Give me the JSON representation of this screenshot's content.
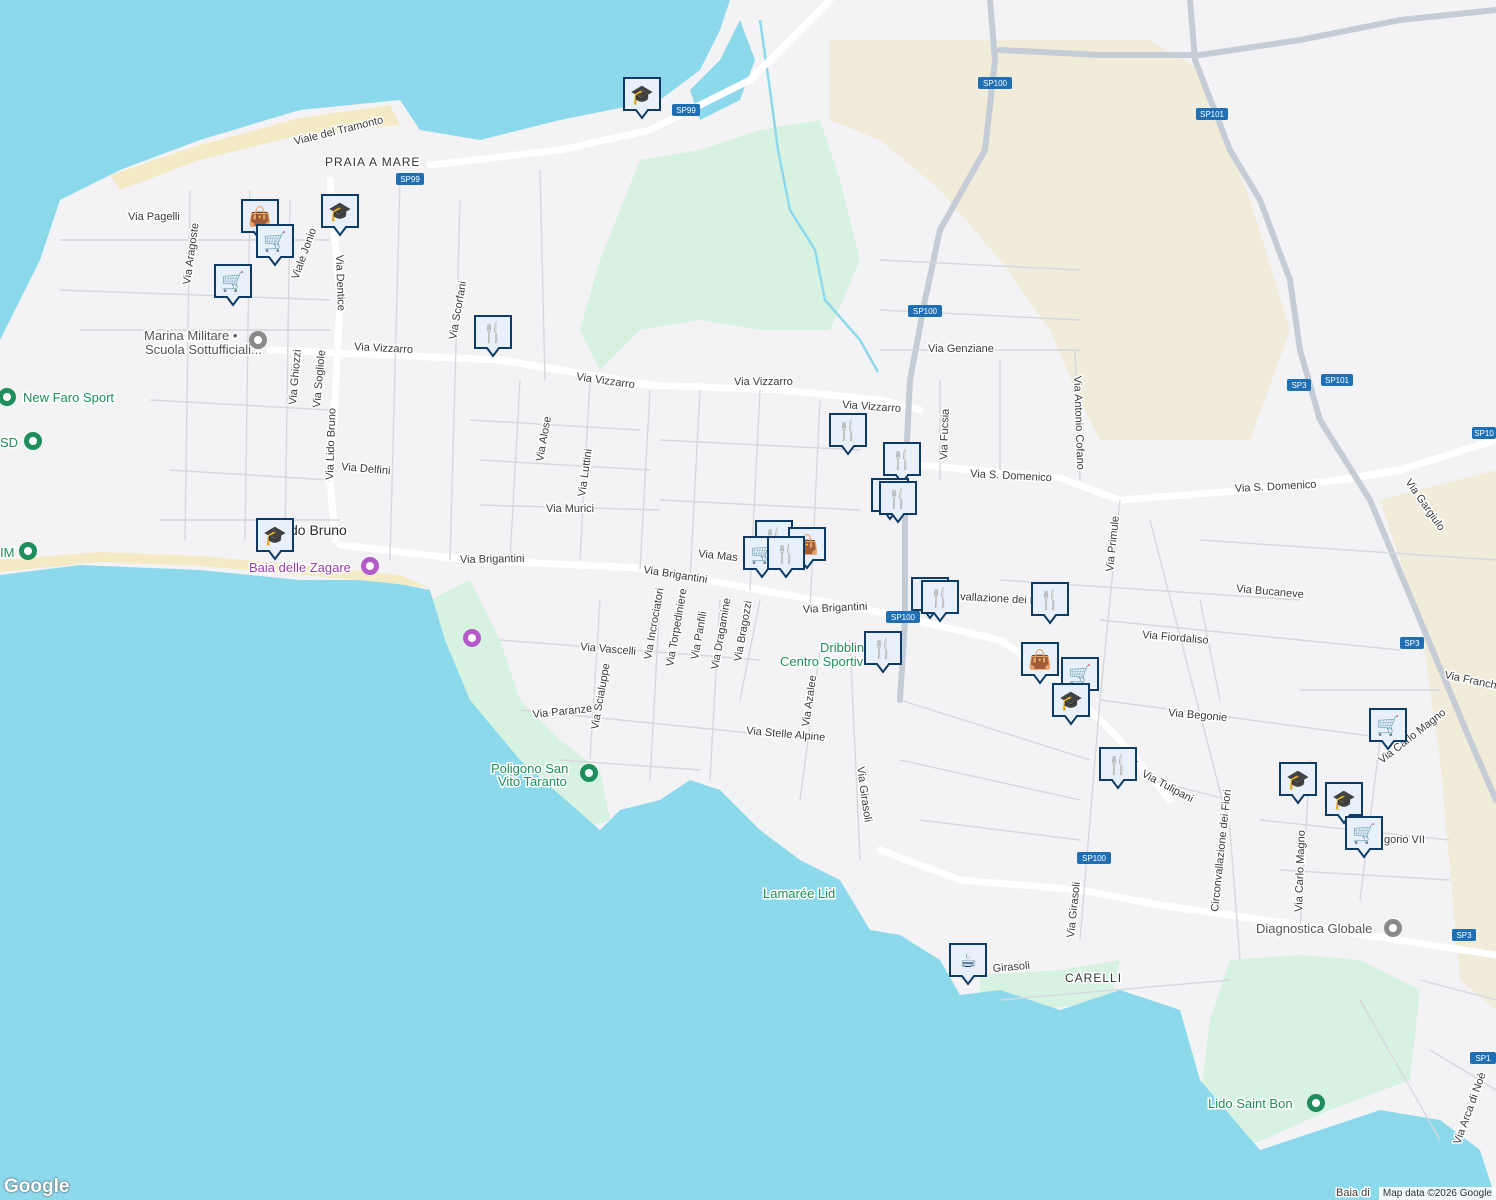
{
  "colors": {
    "water": "#8dd9ec",
    "land": "#f3f3f5",
    "park": "#d8f2e2",
    "agricultural": "#f1ebd9",
    "beach": "#f5eac6",
    "road": "#ffffff",
    "highway": "#c4ccd5",
    "marker_fill": "#e8f1fb",
    "marker_border": "#0d3b66"
  },
  "streets": {
    "viale_tramonto": "Viale del Tramonto",
    "praia_a_mare": "PRAIA A MARE",
    "via_pagelli": "Via Pagelli",
    "via_aragoste": "Via Aragoste",
    "viale_jonio": "Viale Jonio",
    "via_dentice": "Via Dentice",
    "via_scorfani": "Via Scorfani",
    "via_vizzarro_1": "Via Vizzarro",
    "via_vizzarro_2": "Via Vizzarro",
    "via_vizzarro_3": "Via Vizzarro",
    "via_vizzarro_4": "Via Vizzarro",
    "via_ghiozzi": "Via Ghiozzi",
    "via_sogliole": "Via Sogliole",
    "via_lido_bruno": "Via Lido Bruno",
    "via_alose": "Via Alose",
    "via_luttini": "Via Luttini",
    "via_delfini": "Via Delfini",
    "via_murici": "Via Murici",
    "via_brigantini_1": "Via Brigantini",
    "via_brigantini_2": "Via Brigantini",
    "via_brigantini_3": "Via Brigantini",
    "via_mas": "Via Mas",
    "via_incrociatori": "Via Incrociatori",
    "via_torpediniere": "Via Torpediniere",
    "via_panfili": "Via Panfili",
    "via_dragamine": "Via Dragamine",
    "via_bragozzi": "Via Bragozzi",
    "via_vascelli": "Via Vascelli",
    "via_scialuppe": "Via Scialuppe",
    "via_paranze": "Via Paranze",
    "via_stelle_alpine": "Via Stelle Alpine",
    "via_azalee": "Via Azalee",
    "via_girasoli_1": "Via Girasoli",
    "via_girasoli_2": "Via Girasoli",
    "girasoli": "Girasoli",
    "via_genziane": "Via Genziane",
    "via_fucsia": "Via Fucsia",
    "via_antonio_cofano": "Via Antonio Cofano",
    "via_s_domenico_1": "Via S. Domenico",
    "via_s_domenico_2": "Via S. Domenico",
    "via_primule": "Via Primule",
    "via_gargiulo": "Via Gargiulo",
    "via_bucaneve": "Via Bucaneve",
    "via_fiordaliso": "Via Fiordaliso",
    "vallazione_dei_fio": "vallazione dei Fio",
    "via_begonie": "Via Begonie",
    "via_tulipani": "Via Tulipani",
    "circonvallazione_dei_fiori": "Circonvallazione dei Fiori",
    "via_carlo_magno_1": "Via Carlo Magno",
    "via_carlo_magno_2": "Via Carlo Magno",
    "gorio_vii": "gorio VII",
    "via_franch": "Via Franch",
    "via_arca_di_noe": "Via Arca di Noè",
    "baia_di": "Baia di",
    "carelli": "CARELLI",
    "lido_bruno": "do Bruno",
    "a_fragment": "a"
  },
  "shields": [
    "SP99",
    "SP99",
    "SP100",
    "SP100",
    "SP100",
    "SP100",
    "SP101",
    "SP101",
    "SP3",
    "SP3",
    "SP3",
    "SP3",
    "SP10",
    "SP1"
  ],
  "pois": {
    "new_faro_sport": "New Faro Sport",
    "sd": "SD",
    "im": "IM",
    "marina_militare_1": "Marina Militare •",
    "marina_militare_2": "Scuola Sottufficiali...",
    "baia_delle_zagare": "Baia delle Zagare",
    "poligono_1": "Poligono San",
    "poligono_2": "Vito Taranto",
    "dribbling_1": "Dribblin",
    "dribbling_2": "Centro Sportiv",
    "lamaree": "Lamarée Lid",
    "diagnostica": "Diagnostica Globale",
    "lido_saint_bon": "Lido Saint Bon"
  },
  "markers": [
    {
      "icon": "school",
      "glyph": "🎓"
    },
    {
      "icon": "shopping-bag",
      "glyph": "👜"
    },
    {
      "icon": "cart",
      "glyph": "🛒"
    },
    {
      "icon": "school",
      "glyph": "🎓"
    },
    {
      "icon": "cart",
      "glyph": "🛒"
    },
    {
      "icon": "restaurant",
      "glyph": "🍴"
    },
    {
      "icon": "school",
      "glyph": "🎓"
    },
    {
      "icon": "restaurant",
      "glyph": "🍴"
    },
    {
      "icon": "restaurant",
      "glyph": "🍴"
    },
    {
      "icon": "restaurant",
      "glyph": "🍴"
    },
    {
      "icon": "restaurant",
      "glyph": "🍴"
    },
    {
      "icon": "restaurant",
      "glyph": "🍴"
    },
    {
      "icon": "shopping-bag",
      "glyph": "👜"
    },
    {
      "icon": "cart",
      "glyph": "🛒"
    },
    {
      "icon": "restaurant",
      "glyph": "🍴"
    },
    {
      "icon": "restaurant",
      "glyph": "🍴"
    },
    {
      "icon": "restaurant",
      "glyph": "🍴"
    },
    {
      "icon": "restaurant",
      "glyph": "🍴"
    },
    {
      "icon": "shopping-bag",
      "glyph": "👜"
    },
    {
      "icon": "cart",
      "glyph": "🛒"
    },
    {
      "icon": "school",
      "glyph": "🎓"
    },
    {
      "icon": "restaurant",
      "glyph": "🍴"
    },
    {
      "icon": "restaurant",
      "glyph": "🍴"
    },
    {
      "icon": "coffee",
      "glyph": "☕"
    },
    {
      "icon": "cart",
      "glyph": "🛒"
    },
    {
      "icon": "school",
      "glyph": "🎓"
    },
    {
      "icon": "school",
      "glyph": "🎓"
    },
    {
      "icon": "cart",
      "glyph": "🛒"
    }
  ],
  "branding": {
    "logo": "Google",
    "attribution": "Map data ©2026 Google"
  }
}
